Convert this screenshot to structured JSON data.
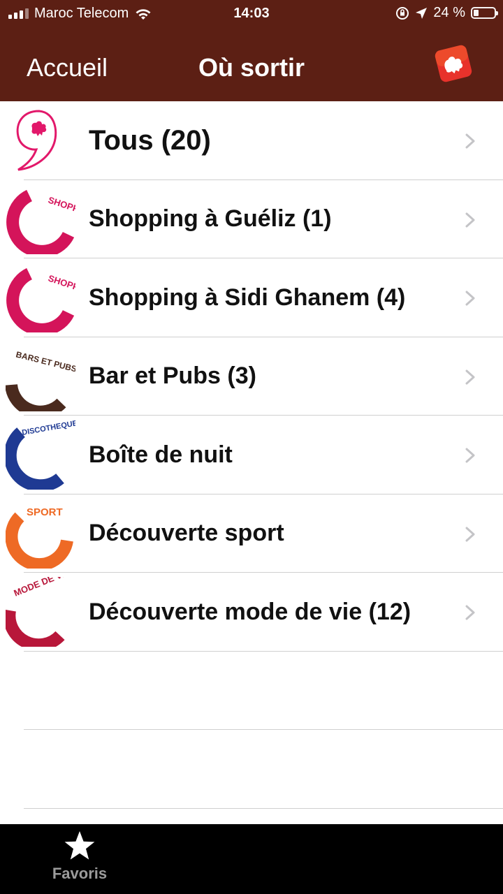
{
  "status_bar": {
    "carrier": "Maroc Telecom",
    "time": "14:03",
    "battery": "24 %",
    "battery_level": 0.24
  },
  "nav": {
    "back_label": "Accueil",
    "title": "Où sortir"
  },
  "items": [
    {
      "label": "Tous (20)",
      "icon": "tous-logo-icon",
      "icon_text": "",
      "color": "#e2186a"
    },
    {
      "label": "Shopping à Guéliz (1)",
      "icon": "shopping-icon",
      "icon_text": "SHOPPING",
      "color": "#d4145a"
    },
    {
      "label": "Shopping à Sidi Ghanem (4)",
      "icon": "shopping-icon",
      "icon_text": "SHOPPING",
      "color": "#d4145a"
    },
    {
      "label": "Bar et Pubs (3)",
      "icon": "bars-pubs-icon",
      "icon_text": "BARS ET PUBS",
      "color": "#4a2a1e"
    },
    {
      "label": "Boîte de nuit",
      "icon": "discotheques-icon",
      "icon_text": "DISCOTHEQUES",
      "color": "#1f3a93"
    },
    {
      "label": "Découverte sport",
      "icon": "sport-icon",
      "icon_text": "SPORT",
      "color": "#ee6a25"
    },
    {
      "label": "Découverte mode de vie (12)",
      "icon": "mode-de-vie-icon",
      "icon_text": "MODE DE VIE",
      "color": "#b8173a"
    }
  ],
  "tab_bar": {
    "favorites_label": "Favoris"
  },
  "colors": {
    "bar_brown": "#5c1f14",
    "logo_red": "#e8322b"
  }
}
